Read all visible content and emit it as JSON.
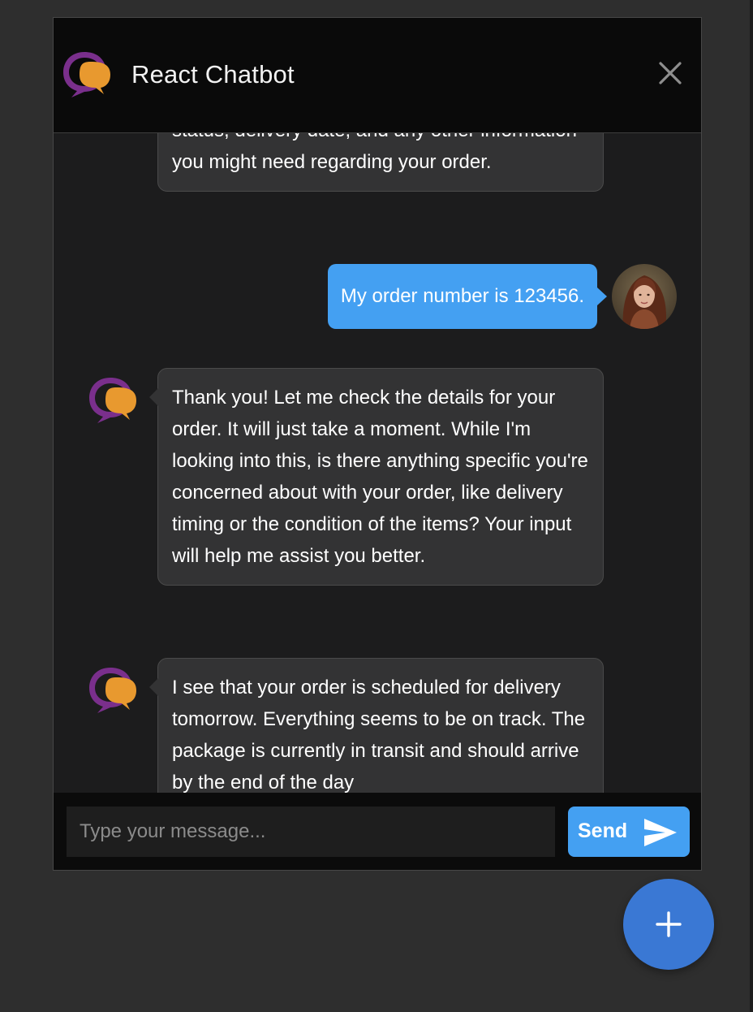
{
  "header": {
    "title": "React Chatbot",
    "logo_icon": "chat-bubbles-logo-icon",
    "close_icon": "close-icon"
  },
  "messages": [
    {
      "sender": "bot",
      "text": "status, delivery date, and any other information you might need regarding your order."
    },
    {
      "sender": "user",
      "text": "My order number is 123456."
    },
    {
      "sender": "bot",
      "text": "Thank you! Let me check the details for your order. It will just take a moment. While I'm looking into this, is there anything specific you're concerned about with your order, like delivery timing or the condition of the items? Your input will help me assist you better."
    },
    {
      "sender": "bot",
      "text": "I see that your order is scheduled for delivery tomorrow. Everything seems to be on track. The package is currently in transit and should arrive by the end of the day"
    }
  ],
  "input": {
    "placeholder": "Type your message...",
    "value": ""
  },
  "send": {
    "label": "Send",
    "icon": "send-arrow-icon"
  },
  "fab": {
    "icon": "plus-icon"
  },
  "colors": {
    "accent": "#44a0f2",
    "logo_purple": "#7a2f8c",
    "logo_orange": "#e8992f",
    "fab": "#3a78d4"
  }
}
